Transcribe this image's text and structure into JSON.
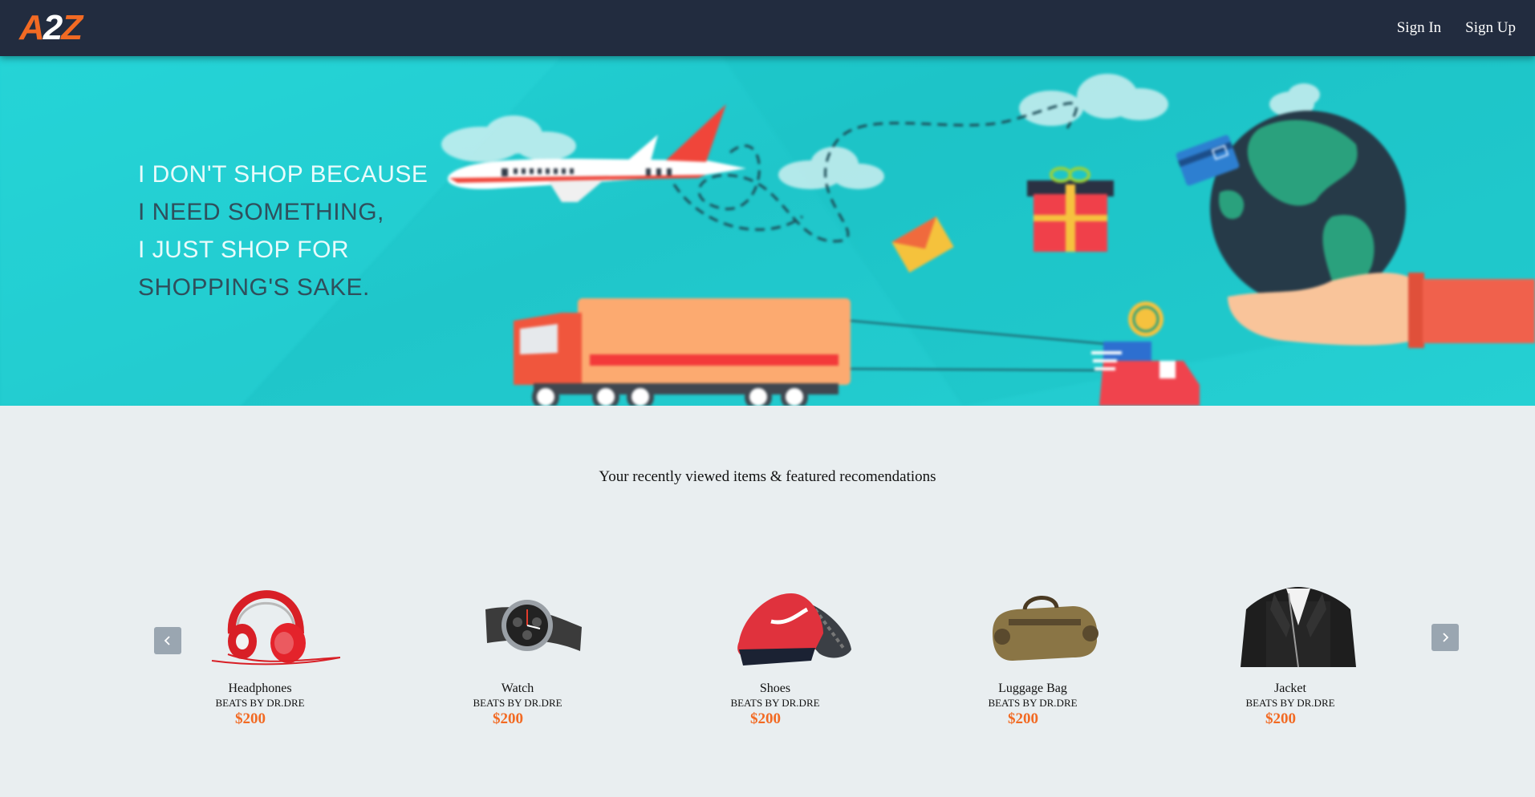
{
  "header": {
    "logo_left": "A",
    "logo_mid": "2",
    "logo_right": "Z",
    "sign_in": "Sign In",
    "sign_up": "Sign Up"
  },
  "hero": {
    "slogan": [
      "I DON'T SHOP BECAUSE",
      "I NEED SOMETHING,",
      "I JUST SHOP FOR",
      "SHOPPING'S SAKE."
    ]
  },
  "section": {
    "title": "Your recently viewed items & featured recomendations"
  },
  "products": [
    {
      "name": "Headphones",
      "brand": "BEATS BY DR.DRE",
      "price": "$200",
      "icon": "headphones-image"
    },
    {
      "name": "Watch",
      "brand": "BEATS BY DR.DRE",
      "price": "$200",
      "icon": "watch-image"
    },
    {
      "name": "Shoes",
      "brand": "BEATS BY DR.DRE",
      "price": "$200",
      "icon": "shoes-image"
    },
    {
      "name": "Luggage Bag",
      "brand": "BEATS BY DR.DRE",
      "price": "$200",
      "icon": "luggage-bag-image"
    },
    {
      "name": "Jacket",
      "brand": "BEATS BY DR.DRE",
      "price": "$200",
      "icon": "jacket-image"
    }
  ],
  "colors": {
    "header_bg": "#222c3f",
    "accent": "#f26a23",
    "hero_bg": "#22d3d6",
    "page_bg": "#e9eef0"
  }
}
